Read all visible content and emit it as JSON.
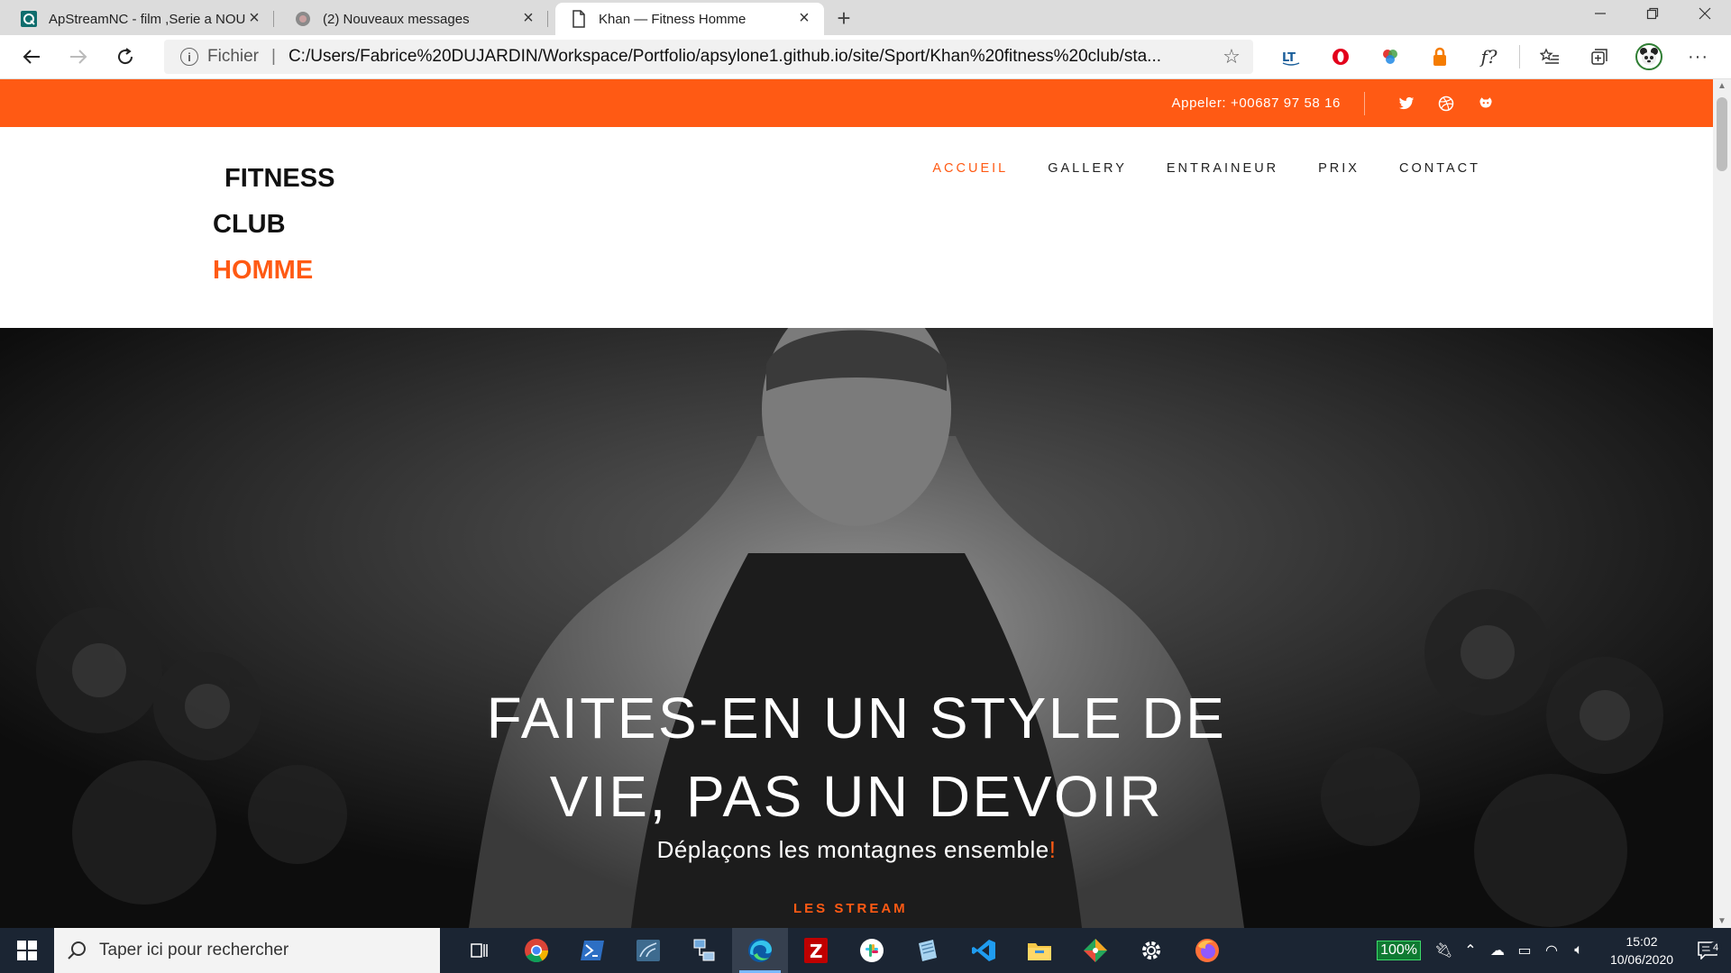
{
  "browser": {
    "tabs": [
      {
        "label": "ApStreamNC - film ,Serie a NOU",
        "active": false,
        "favicon": "apstream-icon"
      },
      {
        "label": "(2) Nouveaux messages",
        "active": false,
        "favicon": "messenger-icon"
      },
      {
        "label": "Khan — Fitness Homme",
        "active": true,
        "favicon": "document-icon"
      }
    ],
    "new_tab": "+",
    "address": {
      "scheme": "Fichier",
      "separator": "|",
      "url": "C:/Users/Fabrice%20DUJARDIN/Workspace/Portfolio/apsylone1.github.io/site/Sport/Khan%20fitness%20club/sta..."
    },
    "more": "···"
  },
  "site": {
    "topbar": {
      "phone": "Appeler: +00687 97 58 16",
      "social": [
        "twitter-icon",
        "dribbble-icon",
        "github-icon"
      ]
    },
    "logo": {
      "line1": "FITNESS",
      "line2": "CLUB",
      "line3": "HOMME"
    },
    "menu": [
      {
        "label": "ACCUEIL",
        "active": true
      },
      {
        "label": "GALLERY",
        "active": false
      },
      {
        "label": "ENTRAINEUR",
        "active": false
      },
      {
        "label": "PRIX",
        "active": false
      },
      {
        "label": "CONTACT",
        "active": false
      }
    ],
    "hero": {
      "title_line1": "FAITES-EN UN STYLE DE",
      "title_line2": "VIE, PAS UN DEVOIR",
      "subtitle": "Déplaçons les montagnes ensemble",
      "subtitle_mark": "!",
      "tag": "LES STREAM"
    },
    "accent": "#ff5a14"
  },
  "taskbar": {
    "search_placeholder": "Taper ici pour rechercher",
    "battery": "100%",
    "time": "15:02",
    "date": "10/06/2020",
    "notifications": "4"
  }
}
